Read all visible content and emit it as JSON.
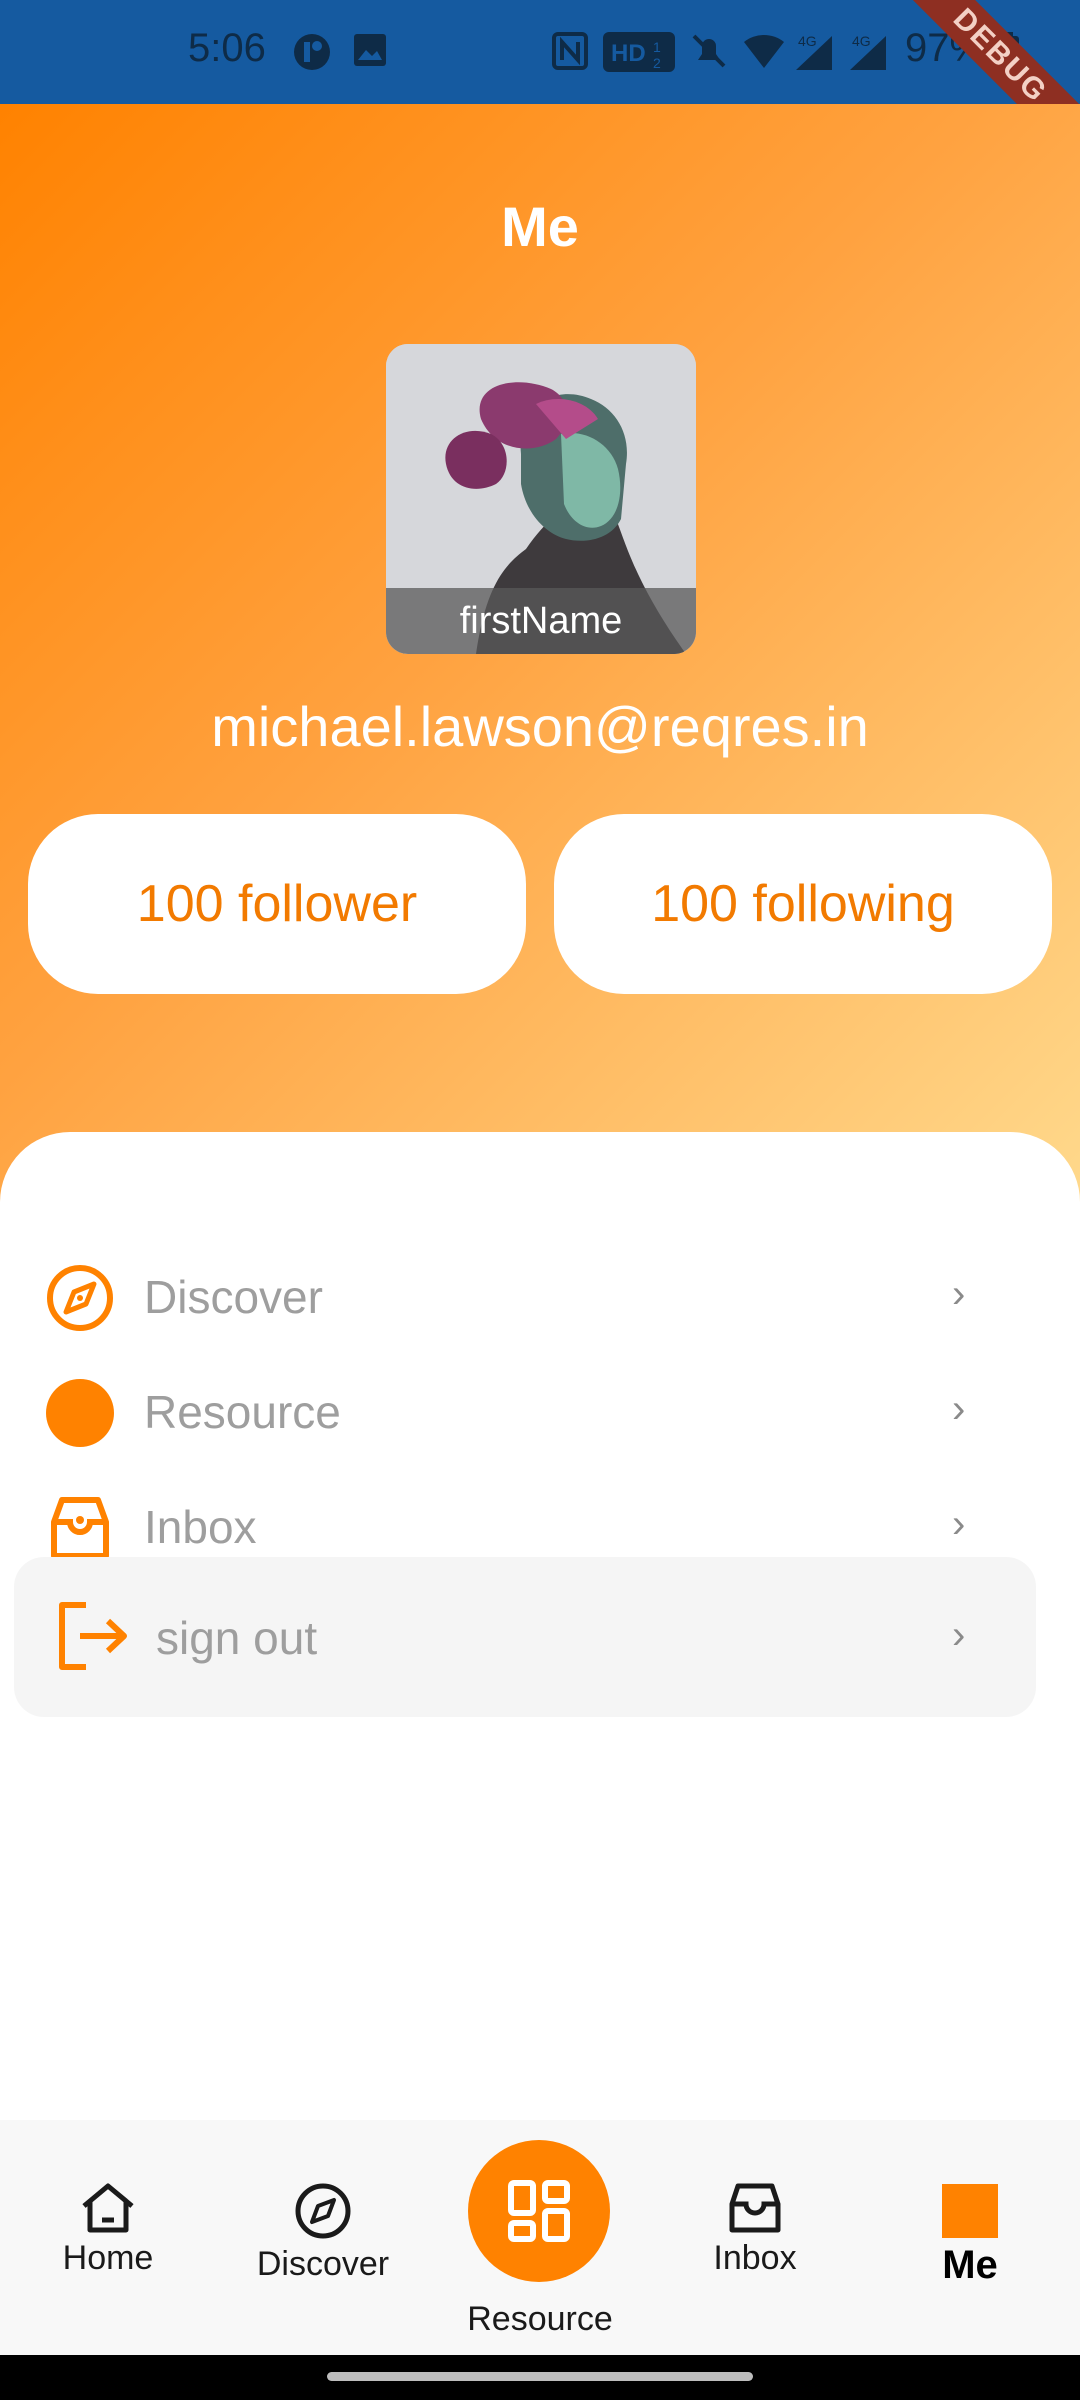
{
  "status_bar": {
    "time": "5:06",
    "battery": "97%",
    "icons": [
      "notification-icon",
      "image-icon",
      "nfc-icon",
      "hd-icon",
      "mute-icon",
      "wifi-icon",
      "signal-4g-icon",
      "signal-4g-icon",
      "battery-icon"
    ]
  },
  "debug_banner": "DEBUG",
  "header": {
    "title": "Me",
    "avatar_caption": "firstName",
    "email": "michael.lawson@reqres.in",
    "follower": "100 follower",
    "following": "100 following"
  },
  "menu": {
    "items": [
      {
        "label": "Discover",
        "icon": "compass-icon"
      },
      {
        "label": "Resource",
        "icon": "circle-icon"
      },
      {
        "label": "Inbox",
        "icon": "inbox-icon"
      }
    ],
    "signout": {
      "label": "sign out",
      "icon": "logout-icon"
    }
  },
  "bottom_nav": {
    "items": [
      {
        "label": "Home",
        "icon": "home-icon"
      },
      {
        "label": "Discover",
        "icon": "compass-icon"
      },
      {
        "label": "Resource",
        "icon": "grid-icon"
      },
      {
        "label": "Inbox",
        "icon": "inbox-icon"
      },
      {
        "label": "Me",
        "icon": "square-icon",
        "active": true
      }
    ]
  },
  "colors": {
    "accent": "#ff8200",
    "status_bar": "#155aa0"
  }
}
